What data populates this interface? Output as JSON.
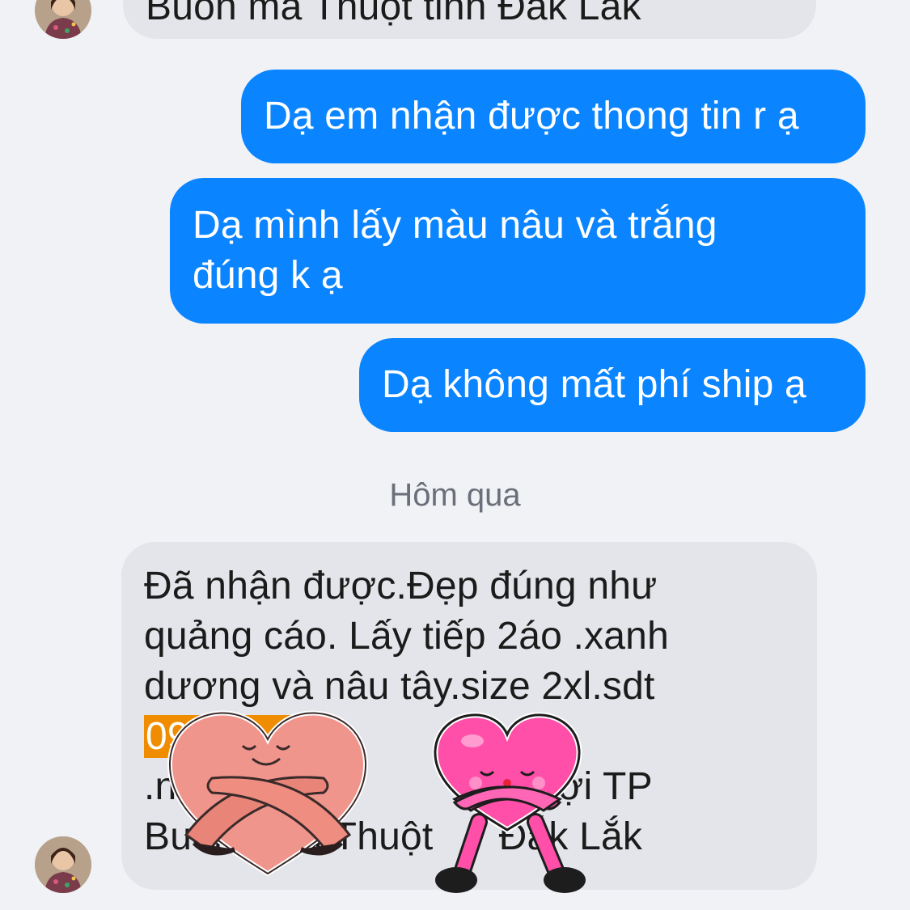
{
  "messages": [
    {
      "from": "contact",
      "lines": [
        "Buôn ma Thuột tỉnh Đắk Lắk"
      ]
    },
    {
      "from": "me",
      "lines": [
        "Dạ em nhận được thong tin r ạ"
      ]
    },
    {
      "from": "me",
      "lines": [
        "Dạ mình lấy màu nâu và trắng",
        "đúng k ạ"
      ]
    },
    {
      "from": "me",
      "lines": [
        "Dạ không mất phí ship ạ"
      ]
    },
    {
      "from": "contact",
      "lines": [
        "Đã nhận được.Đẹp đúng như",
        "quảng cáo. Lấy tiếp 2áo .xanh",
        "dương và nâu tây.size 2xl.sdt",
        "09        11",
        ".n         uyễn         Tân Lợi TP",
        "Buôn      a Thuột      Đắk Lắk"
      ],
      "highlighted_line_index": 3
    }
  ],
  "date_separator": "Hôm qua",
  "stickers": [
    {
      "icon": "hugging-heart-sticker",
      "color": "#f0958c"
    },
    {
      "icon": "hugging-heart-sticker",
      "color": "#ff4fa8"
    }
  ],
  "colors": {
    "background": "#f1f2f6",
    "outgoing_bubble": "#0a84ff",
    "incoming_bubble": "#e4e5ea",
    "phone_highlight": "#f08c00"
  }
}
